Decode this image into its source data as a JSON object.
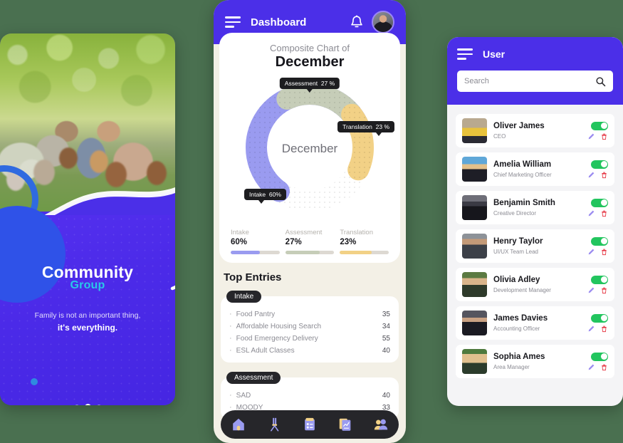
{
  "colors": {
    "page_background": "#4a7050",
    "brand_purple": "#4b2fe8",
    "accent_cyan": "#2ac8e8",
    "intake_color": "#9a9bf0",
    "assessment_color": "#c6cdb8",
    "translation_color": "#f2d186",
    "toggle_on": "#22c55e",
    "delete_red": "#e63946",
    "edit_purple": "#9b8cf0",
    "phone_body": "#f3f0e6"
  },
  "onboarding": {
    "logo_line1": "Community",
    "logo_line2": "Group",
    "tagline_line1": "Family is not an important thing,",
    "tagline_line2": "it's everything.",
    "photo_alt": "family-photo",
    "pager": {
      "total": 3,
      "active_index": 1
    }
  },
  "dashboard": {
    "header": {
      "menu_icon": "hamburger-icon",
      "title": "Dashboard",
      "bell_icon": "bell-icon",
      "avatar": "user-avatar"
    },
    "chart_card": {
      "subtitle": "Composite Chart of",
      "title": "December",
      "center_label": "December",
      "pills": [
        {
          "label": "Assessment",
          "value": "27 %"
        },
        {
          "label": "Translation",
          "value": "23 %"
        },
        {
          "label": "Intake",
          "value": "60%"
        }
      ]
    },
    "stats": [
      {
        "label": "Intake",
        "value": "60%",
        "pct": 60,
        "color": "#9a9bf0"
      },
      {
        "label": "Assessment",
        "value": "27%",
        "pct": 70,
        "color": "#c6cdb8"
      },
      {
        "label": "Translation",
        "value": "23%",
        "pct": 65,
        "color": "#f2d186"
      }
    ],
    "top_entries": {
      "title": "Top Entries",
      "groups": [
        {
          "tag": "Intake",
          "rows": [
            {
              "name": "Food Pantry",
              "value": "35"
            },
            {
              "name": "Affordable Housing Search",
              "value": "34"
            },
            {
              "name": "Food Emergency Delivery",
              "value": "55"
            },
            {
              "name": "ESL Adult Classes",
              "value": "40"
            }
          ]
        },
        {
          "tag": "Assessment",
          "rows": [
            {
              "name": "SAD",
              "value": "40"
            },
            {
              "name": "MOODY",
              "value": "33"
            }
          ]
        }
      ]
    },
    "bottom_nav": [
      {
        "icon": "home-icon",
        "active": true
      },
      {
        "icon": "microscope-icon",
        "active": false
      },
      {
        "icon": "clipboard-icon",
        "active": false
      },
      {
        "icon": "report-icon",
        "active": false
      },
      {
        "icon": "users-icon",
        "active": false
      }
    ]
  },
  "chart_data": {
    "type": "pie",
    "title": "Composite Chart of December",
    "center_label": "December",
    "categories": [
      "Intake",
      "Assessment",
      "Translation"
    ],
    "values": [
      60,
      27,
      23
    ],
    "unit": "%",
    "colors": [
      "#9a9bf0",
      "#c6cdb8",
      "#f2d186"
    ],
    "legend_position": "bottom",
    "annotations": [
      "Assessment 27 %",
      "Translation 23 %",
      "Intake 60%"
    ]
  },
  "user_panel": {
    "menu_icon": "hamburger-icon",
    "title": "User",
    "search": {
      "placeholder": "Search",
      "value": "",
      "icon": "search-icon"
    },
    "row_icons": {
      "edit": "pencil-icon",
      "delete": "trash-icon",
      "toggle": "status-toggle"
    },
    "users": [
      {
        "name": "Oliver James",
        "role": "CEO",
        "enabled": true,
        "av": "a"
      },
      {
        "name": "Amelia William",
        "role": "Chief Marketing Officer",
        "enabled": true,
        "av": "b"
      },
      {
        "name": "Benjamin Smith",
        "role": "Creative Director",
        "enabled": true,
        "av": "c"
      },
      {
        "name": "Henry Taylor",
        "role": "UI/UX Team Lead",
        "enabled": true,
        "av": "d"
      },
      {
        "name": "Olivia Adley",
        "role": "Development Manager",
        "enabled": true,
        "av": "e"
      },
      {
        "name": "James Davies",
        "role": "Accounting Officer",
        "enabled": true,
        "av": "f"
      },
      {
        "name": "Sophia Ames",
        "role": "Area Manager",
        "enabled": true,
        "av": "g"
      }
    ]
  }
}
